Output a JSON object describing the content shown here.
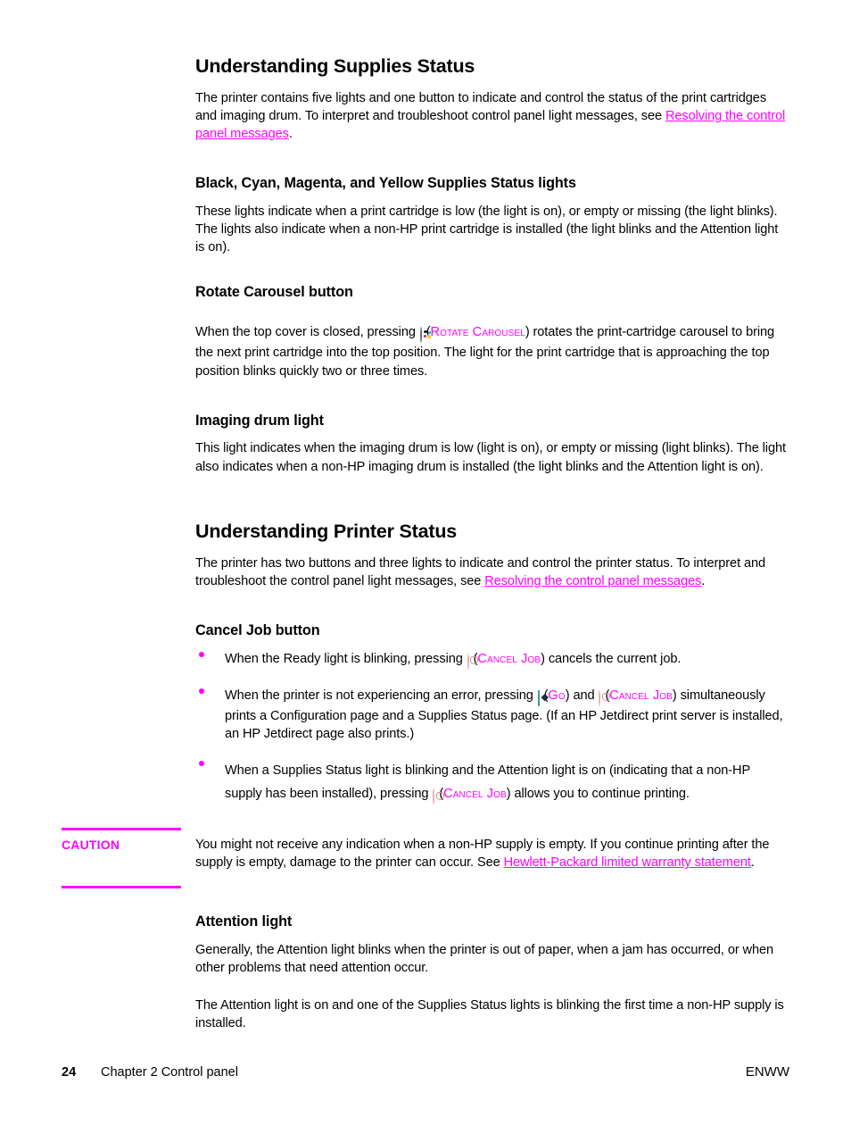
{
  "page": {
    "number": "24",
    "chapter_crumb": "Chapter 2  Control panel",
    "locale": "ENWW",
    "link_color": "#ff00ff",
    "text_color": "#000000"
  },
  "sections": {
    "supplies_status": {
      "title": "Understanding Supplies Status",
      "intro_part1": "The printer contains five lights and one button to indicate and control the status of the print cartridges and imaging drum. To interpret and troubleshoot control panel light messages, see ",
      "intro_link": "Resolving the control panel messages",
      "intro_part2": "."
    },
    "cmyk_lights": {
      "title": "Black, Cyan, Magenta, and Yellow Supplies Status lights",
      "body": "These lights indicate when a print cartridge is low (the light is on), or empty or missing (the light blinks). The lights also indicate when a non-HP print cartridge is installed (the light blinks and the Attention light is on)."
    },
    "rotate_carousel": {
      "title": "Rotate Carousel button",
      "body_part1": "When the top cover is closed, pressing ",
      "icon": "rotate-carousel-icon",
      "body_part2": " (",
      "button_name": "Rotate Carousel",
      "body_part3": ") rotates the print-cartridge carousel to bring the next print cartridge into the top position. The light for the print cartridge that is approaching the top position blinks quickly two or three times."
    },
    "imaging_drum": {
      "title": "Imaging drum light",
      "body": "This light indicates when the imaging drum is low (light is on), or empty or missing (light blinks). The light also indicates when a non-HP imaging drum is installed (the light blinks and the Attention light is on)."
    },
    "printer_status": {
      "title": "Understanding Printer Status",
      "intro_part1": "The printer has two buttons and three lights to indicate and control the printer status. To interpret and troubleshoot the control panel light messages, see ",
      "intro_link": "Resolving the control panel messages",
      "intro_part2": "."
    },
    "cancel_job": {
      "title": "Cancel Job button",
      "bullets": [
        {
          "part1": "When the Ready light is blinking, pressing ",
          "icon1": "cancel-job-icon",
          "part2": " (",
          "caps1": "Cancel Job",
          "part3": ") cancels the current job."
        },
        {
          "part1": "When the printer is not experiencing an error, pressing ",
          "icon1": "go-icon",
          "part2": " (",
          "caps1": "Go",
          "part3": ") and ",
          "icon2": "cancel-job-icon",
          "part4": " (",
          "caps2": "Cancel Job",
          "part5": ") simultaneously prints a Configuration page and a Supplies Status page. (If an HP Jetdirect print server is installed, an HP Jetdirect page also prints.)"
        },
        {
          "part1": "When a Supplies Status light is blinking and the Attention light is on (indicating that a non-HP supply has been installed), pressing ",
          "icon1": "cancel-job-icon",
          "part2": " (",
          "caps1": "Cancel Job",
          "part3": ") allows you to continue printing."
        }
      ]
    },
    "caution": {
      "label": "CAUTION",
      "text_part1": "You might not receive any indication when a non-HP supply is empty. If you continue printing after the supply is empty, damage to the printer can occur. See ",
      "link": "Hewlett-Packard limited warranty statement",
      "text_part2": "."
    },
    "attention_light": {
      "title": "Attention light",
      "para1": "Generally, the Attention light blinks when the printer is out of paper, when a jam has occurred, or when other problems that need attention occur.",
      "para2": "The Attention light is on and one of the Supplies Status lights is blinking the first time a non-HP supply is installed."
    }
  }
}
